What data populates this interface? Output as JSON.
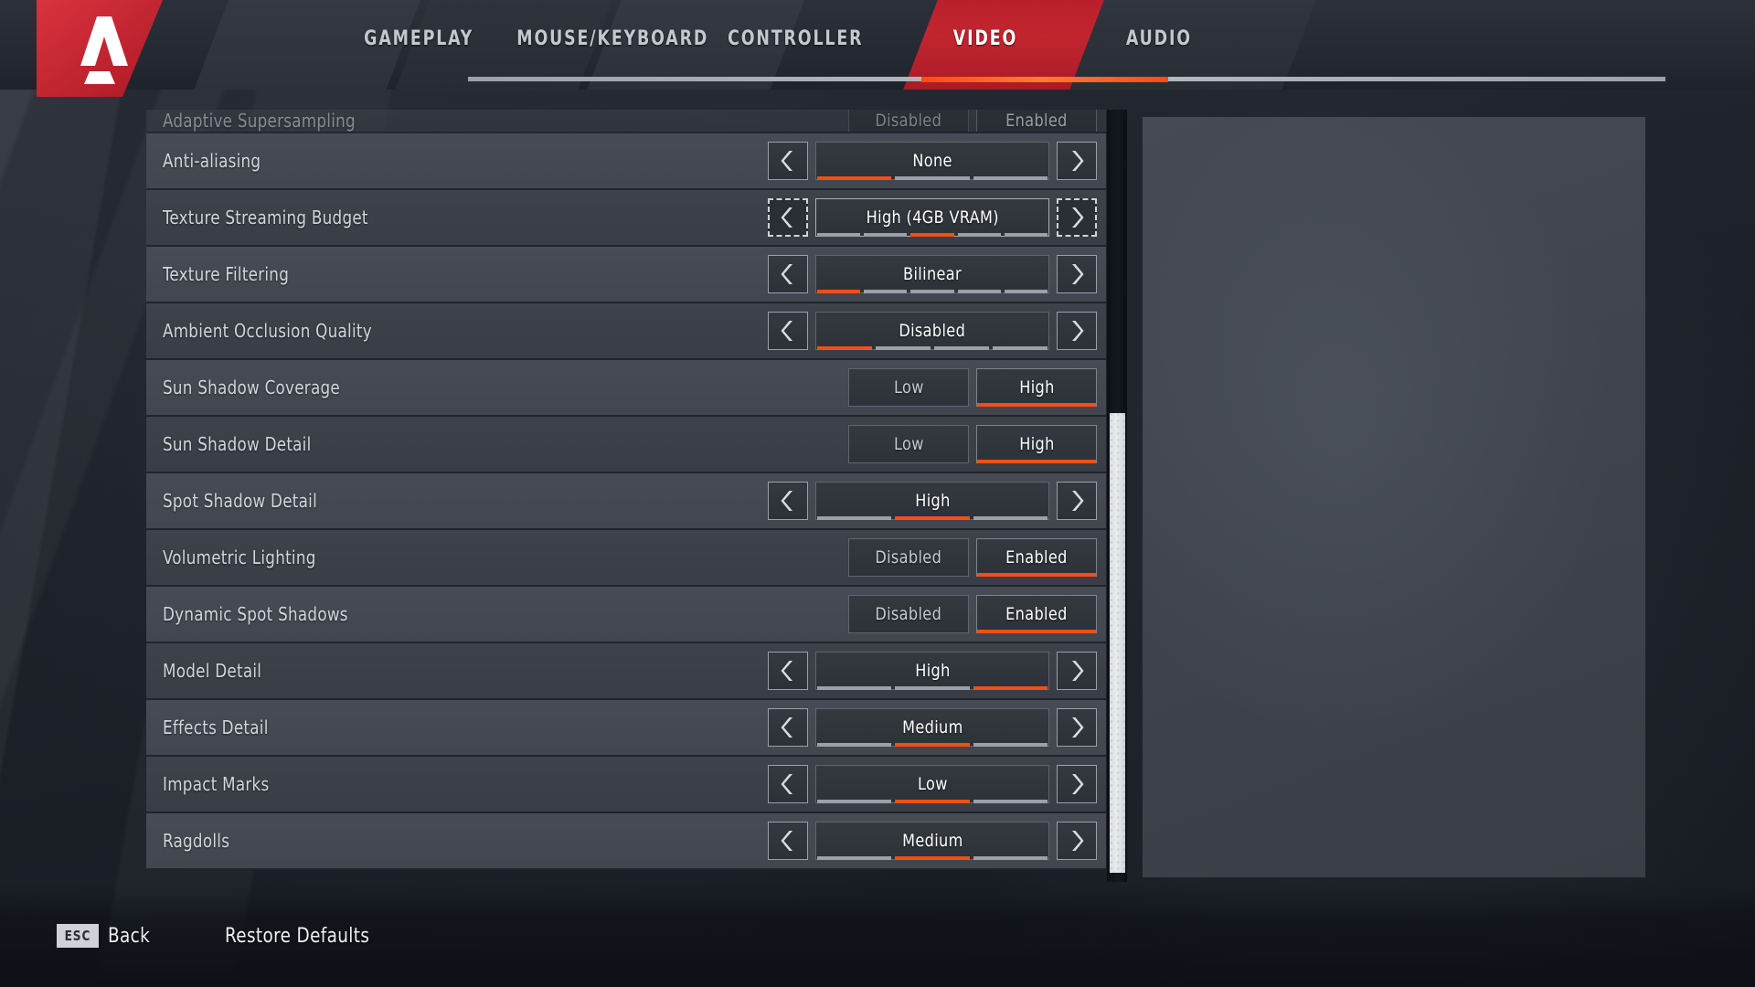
{
  "app": {
    "title": "Apex Legends Settings",
    "logo_icon": "apex-logo-icon"
  },
  "nav": {
    "tabs": [
      {
        "label": "GAMEPLAY",
        "active": false
      },
      {
        "label": "MOUSE/KEYBOARD",
        "active": false
      },
      {
        "label": "CONTROLLER",
        "active": false
      },
      {
        "label": "VIDEO",
        "active": true
      },
      {
        "label": "AUDIO",
        "active": false
      }
    ],
    "active_tab": "VIDEO",
    "highlight_color": "#b9202b",
    "underline_color": "#ff4a14"
  },
  "settings": {
    "accent_color": "#f24f18",
    "rows": [
      {
        "label": "Adaptive Supersampling",
        "type": "toggle",
        "clipped": true,
        "options": [
          "Disabled",
          "Enabled"
        ],
        "value": "Enabled"
      },
      {
        "label": "Anti-aliasing",
        "type": "stepper",
        "value": "None",
        "segments": 3,
        "active_segment": 1,
        "focused": false
      },
      {
        "label": "Texture Streaming Budget",
        "type": "stepper",
        "value": "High (4GB VRAM)",
        "segments": 5,
        "active_segment": 3,
        "focused": true
      },
      {
        "label": "Texture Filtering",
        "type": "stepper",
        "value": "Bilinear",
        "segments": 5,
        "active_segment": 1,
        "focused": false
      },
      {
        "label": "Ambient Occlusion Quality",
        "type": "stepper",
        "value": "Disabled",
        "segments": 4,
        "active_segment": 1,
        "focused": false
      },
      {
        "label": "Sun Shadow Coverage",
        "type": "toggle",
        "options": [
          "Low",
          "High"
        ],
        "value": "High"
      },
      {
        "label": "Sun Shadow Detail",
        "type": "toggle",
        "options": [
          "Low",
          "High"
        ],
        "value": "High"
      },
      {
        "label": "Spot Shadow Detail",
        "type": "stepper",
        "value": "High",
        "segments": 3,
        "active_segment": 2,
        "focused": false
      },
      {
        "label": "Volumetric Lighting",
        "type": "toggle",
        "options": [
          "Disabled",
          "Enabled"
        ],
        "value": "Enabled"
      },
      {
        "label": "Dynamic Spot Shadows",
        "type": "toggle",
        "options": [
          "Disabled",
          "Enabled"
        ],
        "value": "Enabled"
      },
      {
        "label": "Model Detail",
        "type": "stepper",
        "value": "High",
        "segments": 3,
        "active_segment": 3,
        "focused": false
      },
      {
        "label": "Effects Detail",
        "type": "stepper",
        "value": "Medium",
        "segments": 3,
        "active_segment": 2,
        "focused": false
      },
      {
        "label": "Impact Marks",
        "type": "stepper",
        "value": "Low",
        "segments": 3,
        "active_segment": 2,
        "focused": false
      },
      {
        "label": "Ragdolls",
        "type": "stepper",
        "value": "Medium",
        "segments": 3,
        "active_segment": 2,
        "focused": false
      }
    ]
  },
  "scrollbar": {
    "position_pct": 48
  },
  "footer": {
    "esc_key": "ESC",
    "back_label": "Back",
    "restore_label": "Restore Defaults"
  }
}
